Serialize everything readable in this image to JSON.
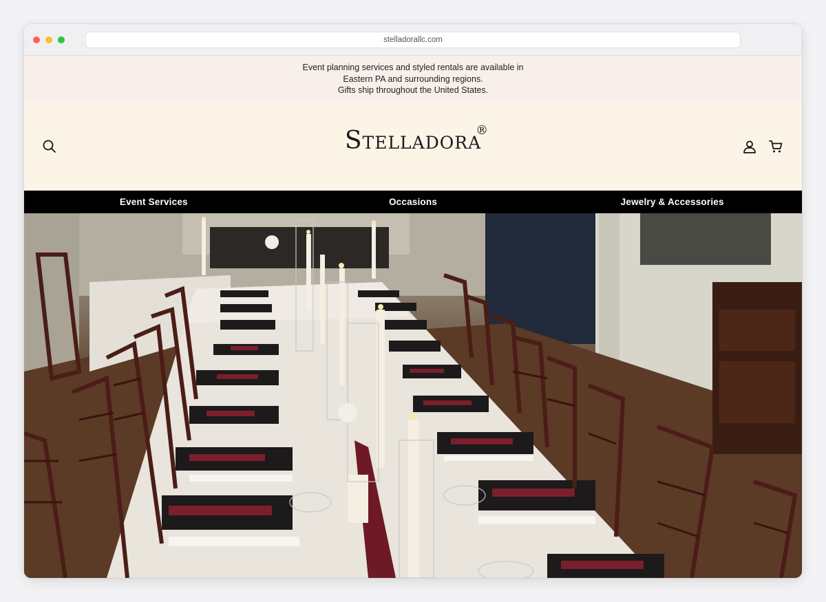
{
  "browser": {
    "url": "stelladorallc.com"
  },
  "announcement": {
    "line1": "Event planning services and styled rentals are available in",
    "line2": "Eastern PA and surrounding regions.",
    "line3": "Gifts ship throughout the United States."
  },
  "header": {
    "logo_text": "Stelladora",
    "logo_mark": "®",
    "icons": {
      "search": "search-icon",
      "account": "account-icon",
      "cart": "cart-icon"
    }
  },
  "nav": {
    "items": [
      {
        "label": "Event Services"
      },
      {
        "label": "Occasions"
      },
      {
        "label": "Jewelry & Accessories"
      }
    ]
  },
  "hero": {
    "image": "banquet-table-photo",
    "colors": {
      "tablecloth": "#e9e4dc",
      "napkin": "#1c1a1a",
      "ribbon": "#7a1f2b",
      "chair": "#4a1d16",
      "wall": "#b7b3a6",
      "floor": "#5b3a26"
    }
  }
}
